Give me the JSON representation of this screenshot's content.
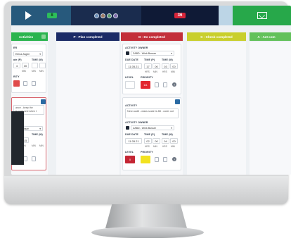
{
  "topbar": {
    "badge_green": "8",
    "badge_red": "36",
    "badge_light": "8"
  },
  "columns": [
    {
      "title": "Activities"
    },
    {
      "title": "P - Plan completed"
    },
    {
      "title": "D - Do completed"
    },
    {
      "title": "C - Check completed"
    },
    {
      "title": "A - Act com"
    }
  ],
  "left_card1": {
    "owner_label": "ER",
    "owner_value": "Elena Zagini",
    "due_label": "ate (P)",
    "time_label": "TIME (M)",
    "due_value": "4",
    "time_values": [
      "30",
      ""
    ],
    "units": [
      "MIN",
      "MIN",
      "MIN"
    ],
    "priority_label": "RITY"
  },
  "left_card2": {
    "text": "ance - keep the\nle work and when t",
    "owner_value": "ierik Busser",
    "due_label": "ate (P)",
    "time_label": "TIME (M)",
    "due_value": "20",
    "time_value": "15",
    "units": [
      "MIN",
      "MIN",
      "MIN"
    ],
    "priority_label": "RITY"
  },
  "do_card1": {
    "owner_label": "ACTIVITY OWNER",
    "owner_value": "ZABD - Wink Busser",
    "due_label": "DUE DATE",
    "time_p_label": "TIME (P)",
    "time_m_label": "TIME (M)",
    "due_value": "11.05.21",
    "times": [
      "17",
      "00",
      "03",
      "00"
    ],
    "units": [
      "HRS",
      "MIN",
      "HRS",
      "MIN"
    ],
    "level_label": "LEVEL",
    "priority_label": "PRIORITY",
    "priority_value": "111"
  },
  "do_card2": {
    "activity_label": "ACTIVITY",
    "activity_text": "New audit - class scale is 88 - code out",
    "owner_label": "ACTIVITY OWNER",
    "owner_value": "ZABD - Wink Busser",
    "due_label": "DUE DATE",
    "time_p_label": "TIME (P)",
    "time_m_label": "TIME (M)",
    "due_value": "11.05.21",
    "times": [
      "02",
      "00",
      "04",
      "00"
    ],
    "units": [
      "HRS",
      "MIN",
      "HRS",
      "MIN"
    ],
    "level_label": "LEVEL",
    "priority_label": "PRIORITY",
    "level_value": "0"
  },
  "help_glyph": "?"
}
